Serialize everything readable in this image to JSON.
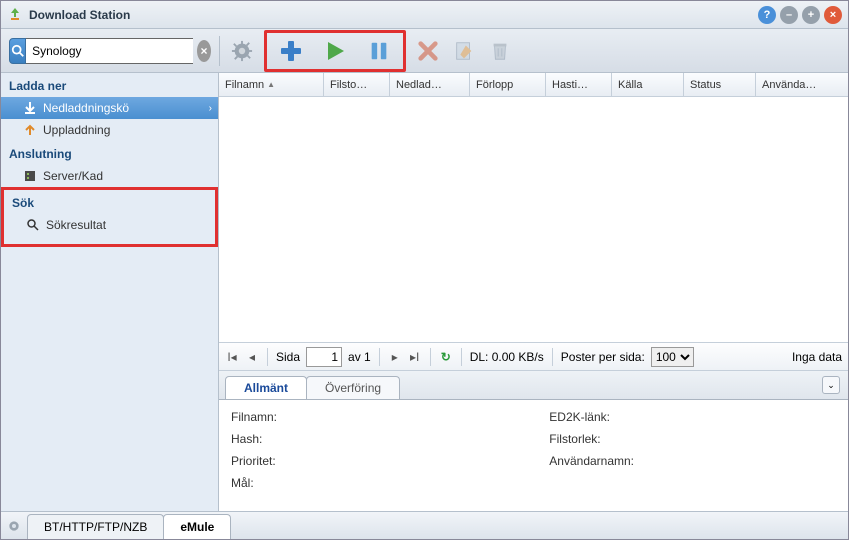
{
  "window": {
    "title": "Download Station"
  },
  "search": {
    "value": "Synology"
  },
  "sidebar": {
    "sections": [
      {
        "title": "Ladda ner",
        "items": [
          {
            "label": "Nedladdningskö",
            "icon": "download",
            "selected": true,
            "chevron": true
          },
          {
            "label": "Uppladdning",
            "icon": "upload"
          }
        ]
      },
      {
        "title": "Anslutning",
        "items": [
          {
            "label": "Server/Kad",
            "icon": "server"
          }
        ]
      },
      {
        "title": "Sök",
        "boxed": true,
        "items": [
          {
            "label": "Sökresultat",
            "icon": "search"
          }
        ]
      }
    ]
  },
  "grid": {
    "columns": [
      "Filnamn",
      "Filsto…",
      "Nedlad…",
      "Förlopp",
      "Hasti…",
      "Källa",
      "Status",
      "Använda…"
    ],
    "sort_col": 0,
    "sort_dir": "asc"
  },
  "pager": {
    "label_page": "Sida",
    "current": "1",
    "of_label": "av 1",
    "dl_label": "DL: 0.00 KB/s",
    "perpage_label": "Poster per sida:",
    "perpage_value": "100",
    "status": "Inga data"
  },
  "details": {
    "tabs": [
      "Allmänt",
      "Överföring"
    ],
    "active": 0,
    "left": [
      "Filnamn:",
      "Hash:",
      "Prioritet:",
      "Mål:"
    ],
    "right": [
      "ED2K-länk:",
      "Filstorlek:",
      "Användarnamn:"
    ]
  },
  "footer": {
    "tabs": [
      "BT/HTTP/FTP/NZB",
      "eMule"
    ],
    "active": 1
  }
}
